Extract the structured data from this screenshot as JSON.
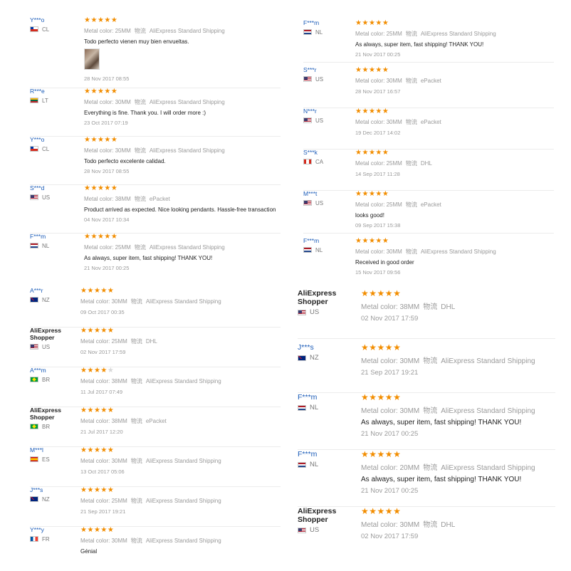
{
  "meta_label": "Metal color:",
  "shipping_zh": "物流",
  "panels": [
    {
      "id": "top-left",
      "reviews": [
        {
          "user": "Y***o",
          "country": "CL",
          "flag": "cl",
          "stars": 5,
          "color": "25MM",
          "shipping": "AliExpress Standard Shipping",
          "text": "Todo perfecto vienen muy bien envueltas.",
          "photo": true,
          "date": "28 Nov 2017 08:55"
        },
        {
          "user": "R***e",
          "country": "LT",
          "flag": "lt",
          "stars": 5,
          "color": "30MM",
          "shipping": "AliExpress Standard Shipping",
          "text": "Everything is fine. Thank you. I will order more :)",
          "date": "23 Oct 2017 07:19"
        },
        {
          "user": "Y***o",
          "country": "CL",
          "flag": "cl",
          "stars": 5,
          "color": "30MM",
          "shipping": "AliExpress Standard Shipping",
          "text": "Todo perfecto excelente calidad.",
          "date": "28 Nov 2017 08:55"
        },
        {
          "user": "S***d",
          "country": "US",
          "flag": "us",
          "stars": 5,
          "color": "38MM",
          "shipping": "ePacket",
          "text": "Product arrived as expected. Nice looking pendants. Hassle-free transaction",
          "date": "04 Nov 2017 10:34"
        },
        {
          "user": "F***m",
          "country": "NL",
          "flag": "nl",
          "stars": 5,
          "color": "25MM",
          "shipping": "AliExpress Standard Shipping",
          "text": "As always, super item, fast shipping! THANK YOU!",
          "date": "21 Nov 2017 00:25"
        }
      ]
    },
    {
      "id": "top-right",
      "reviews": [
        {
          "user": "F***m",
          "country": "NL",
          "flag": "nl",
          "stars": 5,
          "color": "25MM",
          "shipping": "AliExpress Standard Shipping",
          "text": "As always, super item, fast shipping! THANK YOU!",
          "date": "21 Nov 2017 00:25"
        },
        {
          "user": "S***r",
          "country": "US",
          "flag": "us",
          "stars": 5,
          "color": "30MM",
          "shipping": "ePacket",
          "text": "",
          "date": "28 Nov 2017 16:57"
        },
        {
          "user": "N***r",
          "country": "US",
          "flag": "us",
          "stars": 5,
          "color": "30MM",
          "shipping": "ePacket",
          "text": "",
          "date": "19 Dec 2017 14:02"
        },
        {
          "user": "S***k",
          "country": "CA",
          "flag": "ca",
          "stars": 5,
          "color": "25MM",
          "shipping": "DHL",
          "text": "",
          "date": "14 Sep 2017 11:28"
        },
        {
          "user": "M***t",
          "country": "US",
          "flag": "us",
          "stars": 5,
          "color": "25MM",
          "shipping": "ePacket",
          "text": "looks good!",
          "date": "09 Sep 2017 15:38"
        },
        {
          "user": "F***m",
          "country": "NL",
          "flag": "nl",
          "stars": 5,
          "color": "30MM",
          "shipping": "AliExpress Standard Shipping",
          "text": "Received in good order",
          "date": "15 Nov 2017 09:56"
        }
      ]
    },
    {
      "id": "bottom-left",
      "reviews": [
        {
          "user": "A***r",
          "country": "NZ",
          "flag": "nz",
          "stars": 5,
          "color": "30MM",
          "shipping": "AliExpress Standard Shipping",
          "text": "",
          "date": "09 Oct 2017 00:35"
        },
        {
          "user": "AliExpress Shopper",
          "shopper": true,
          "country": "US",
          "flag": "us",
          "stars": 5,
          "color": "25MM",
          "shipping": "DHL",
          "text": "",
          "date": "02 Nov 2017 17:59"
        },
        {
          "user": "A***m",
          "country": "BR",
          "flag": "br",
          "stars": 4,
          "color": "38MM",
          "shipping": "AliExpress Standard Shipping",
          "text": "",
          "date": "11 Jul 2017 07:49"
        },
        {
          "user": "AliExpress Shopper",
          "shopper": true,
          "country": "BR",
          "flag": "br",
          "stars": 5,
          "color": "38MM",
          "shipping": "ePacket",
          "text": "",
          "date": "21 Jul 2017 12:20"
        },
        {
          "user": "M***l",
          "country": "ES",
          "flag": "es",
          "stars": 5,
          "color": "30MM",
          "shipping": "AliExpress Standard Shipping",
          "text": "",
          "date": "13 Oct 2017 05:06"
        },
        {
          "user": "J***s",
          "country": "NZ",
          "flag": "nz",
          "stars": 5,
          "color": "25MM",
          "shipping": "AliExpress Standard Shipping",
          "text": "",
          "date": "21 Sep 2017 19:21"
        },
        {
          "user": "Y***y",
          "country": "FR",
          "flag": "fr",
          "stars": 5,
          "color": "30MM",
          "shipping": "AliExpress Standard Shipping",
          "text": "Génial",
          "date": ""
        }
      ]
    },
    {
      "id": "bottom-right",
      "reviews": [
        {
          "user": "AliExpress Shopper",
          "shopper": true,
          "country": "US",
          "flag": "us",
          "stars": 5,
          "color": "38MM",
          "shipping": "DHL",
          "text": "",
          "date": "02 Nov 2017 17:59"
        },
        {
          "user": "J***s",
          "country": "NZ",
          "flag": "nz",
          "stars": 5,
          "color": "30MM",
          "shipping": "AliExpress Standard Shipping",
          "text": "",
          "date": "21 Sep 2017 19:21"
        },
        {
          "user": "F***m",
          "country": "NL",
          "flag": "nl",
          "stars": 5,
          "color": "30MM",
          "shipping": "AliExpress Standard Shipping",
          "text": "As always, super item, fast shipping! THANK YOU!",
          "date": "21 Nov 2017 00:25"
        },
        {
          "user": "F***m",
          "country": "NL",
          "flag": "nl",
          "stars": 5,
          "color": "20MM",
          "shipping": "AliExpress Standard Shipping",
          "text": "As always, super item, fast shipping! THANK YOU!",
          "date": "21 Nov 2017 00:25"
        },
        {
          "user": "AliExpress Shopper",
          "shopper": true,
          "country": "US",
          "flag": "us",
          "stars": 5,
          "color": "30MM",
          "shipping": "DHL",
          "text": "",
          "date": "02 Nov 2017 17:59"
        }
      ]
    }
  ]
}
